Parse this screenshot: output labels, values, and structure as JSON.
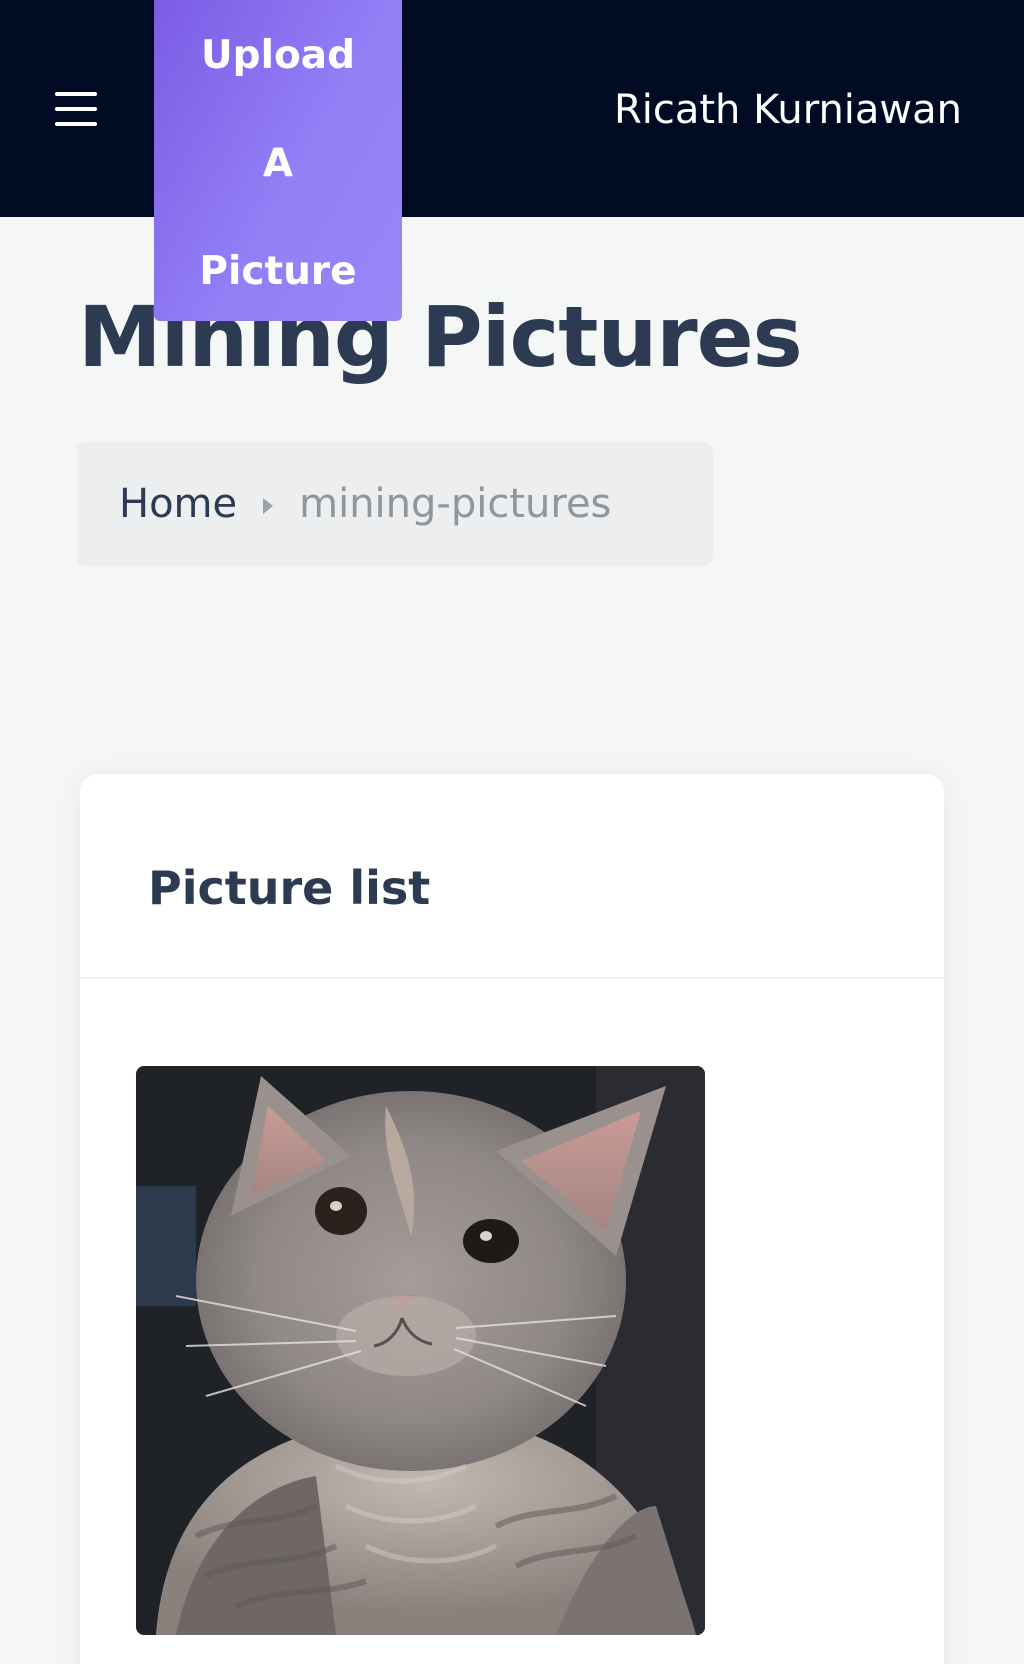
{
  "navbar": {
    "menu_icon": "hamburger-menu-icon",
    "user_name": "Ricath Kurniawan",
    "background_color": "#020b24"
  },
  "upload_button": {
    "label": "Upload A Picture",
    "color_start": "#7b5ce5",
    "color_end": "#9a86f7"
  },
  "header": {
    "title": "Mining Pictures"
  },
  "breadcrumb": {
    "home": "Home",
    "separator_icon": "caret-right-icon",
    "current": "mining-pictures"
  },
  "card": {
    "title": "Picture list",
    "pictures": [
      {
        "subject": "cat-photo"
      }
    ]
  }
}
